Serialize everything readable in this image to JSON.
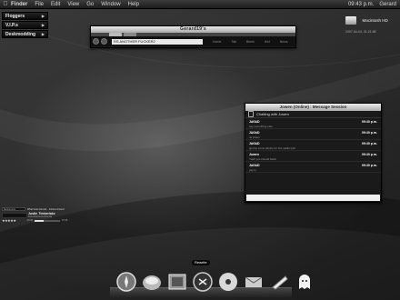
{
  "menubar": {
    "apple_icon": "apple-icon",
    "items": [
      "Finder",
      "File",
      "Edit",
      "View",
      "Go",
      "Window",
      "Help"
    ],
    "clock": "09:43 p.m.",
    "user": "Gerard"
  },
  "sidemenu": {
    "items": [
      {
        "label": "Floggers"
      },
      {
        "label": "V.I.P.s"
      },
      {
        "label": "Deskmodding"
      }
    ]
  },
  "drive": {
    "icon": "hard-drive-icon",
    "name": "Macintosh HD",
    "info": "2007-04-04, 01:21:58"
  },
  "browser": {
    "title": "Gerard19's",
    "url": "RS ANOTHER FUCKER2",
    "toolbar_buttons": [
      "Home",
      "Tab",
      "Bkmk",
      "Hist",
      "News"
    ]
  },
  "chat": {
    "title": "Jowen (Online) : Message Session",
    "status": "Chatting with Jowen",
    "messages": [
      {
        "sender": "J∆G∆D",
        "time": "09:40 p.m.",
        "text": "say something else"
      },
      {
        "sender": "J∆G∆D",
        "time": "09:40 p.m.",
        "text": "ok jowen"
      },
      {
        "sender": "J∆G∆D",
        "time": "09:40 p.m.",
        "text": "gimme some advice for this wallie lolol"
      },
      {
        "sender": "Jowen",
        "time": "09:40 p.m.",
        "text": "Yeah you should black"
      },
      {
        "sender": "J∆G∆D",
        "time": "09:40 p.m.",
        "text": "yay ty"
      }
    ]
  },
  "itunes": {
    "playlist": "Sunrunners",
    "song": "What Goes Around... Comes Around",
    "artist": "Justin Timberlake",
    "album": "FutureSex/LoveSounds",
    "rating": "★★★★★",
    "elapsed": "-00:30",
    "total": "07:28",
    "progress": 0.35
  },
  "dock": {
    "hover_label": "Rewrite",
    "items": [
      {
        "name": "safari-icon"
      },
      {
        "name": "photo-icon"
      },
      {
        "name": "preview-icon"
      },
      {
        "name": "itunes-icon"
      },
      {
        "name": "dvd-icon"
      },
      {
        "name": "mail-icon"
      },
      {
        "name": "text-editor-icon"
      },
      {
        "name": "ghost-icon"
      }
    ]
  },
  "colors": {
    "background": "#262626",
    "window_title": "#eaeaea",
    "accent": "#ffffff"
  }
}
